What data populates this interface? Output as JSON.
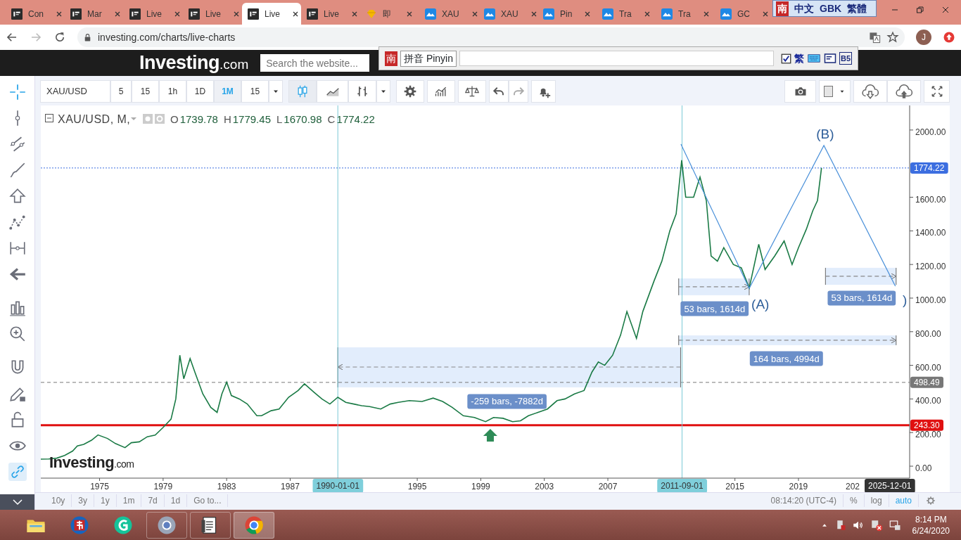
{
  "browser": {
    "tabs": [
      {
        "label": "Con",
        "kind": "investing",
        "selected": false
      },
      {
        "label": "Mar",
        "kind": "investing",
        "selected": false
      },
      {
        "label": "Live",
        "kind": "investing",
        "selected": false
      },
      {
        "label": "Live",
        "kind": "investing",
        "selected": false
      },
      {
        "label": "Live",
        "kind": "investing",
        "selected": true
      },
      {
        "label": "Live",
        "kind": "investing",
        "selected": false
      },
      {
        "label": "即",
        "kind": "gem",
        "selected": false
      },
      {
        "label": "XAU",
        "kind": "cloud",
        "selected": false
      },
      {
        "label": "XAU",
        "kind": "cloud",
        "selected": false
      },
      {
        "label": "Pin",
        "kind": "cloud",
        "selected": false
      },
      {
        "label": "Tra",
        "kind": "cloud",
        "selected": false
      },
      {
        "label": "Tra",
        "kind": "cloud",
        "selected": false
      },
      {
        "label": "GC",
        "kind": "cloud",
        "selected": false
      }
    ],
    "url": "investing.com/charts/live-charts",
    "avatar": "J"
  },
  "ime": {
    "status": [
      "南",
      "中文",
      "GBK",
      "繁體"
    ],
    "pinyin": {
      "logo": "南",
      "mode": "拼音 Pinyin",
      "traditional_checked": true,
      "traditional": "繁",
      "b5": "B5"
    }
  },
  "site": {
    "logo": "Investing",
    "logo_suffix": ".com",
    "search": {
      "placeholder": "Search the website..."
    }
  },
  "toolbar": {
    "symbol": "XAU/USD",
    "intervals": [
      {
        "label": "5",
        "selected": false
      },
      {
        "label": "15",
        "selected": false
      },
      {
        "label": "1h",
        "selected": false
      },
      {
        "label": "1D",
        "selected": false
      },
      {
        "label": "1M",
        "selected": true
      },
      {
        "label": "15",
        "selected": false
      }
    ]
  },
  "chart": {
    "title": "XAU/USD, M,",
    "ohlc": [
      {
        "key": "O",
        "value": "1739.78"
      },
      {
        "key": "H",
        "value": "1779.45"
      },
      {
        "key": "L",
        "value": "1670.98"
      },
      {
        "key": "C",
        "value": "1774.22"
      }
    ],
    "logo": "Investing",
    "logo_suffix": ".com",
    "measurements": [
      "-259 bars, -7882d",
      "53 bars, 1614d",
      "53 bars, 1614d",
      "164 bars, 4994d"
    ],
    "wave_labels": [
      "(A)",
      "(B)",
      ")"
    ],
    "cut_tick": "202",
    "cursor_date": "2025-12-01",
    "date_markers": [
      "1990-01-01",
      "2011-09-01"
    ],
    "chart_data": {
      "type": "line",
      "x": [
        1971.3,
        1971.8,
        1972.3,
        1972.8,
        1973.3,
        1973.6,
        1974.0,
        1974.5,
        1974.9,
        1975.5,
        1976.0,
        1976.6,
        1977.0,
        1977.5,
        1978.0,
        1978.5,
        1979.0,
        1979.5,
        1979.8,
        1980.05,
        1980.3,
        1980.7,
        1981.0,
        1981.5,
        1982.0,
        1982.4,
        1982.7,
        1983.0,
        1983.3,
        1983.8,
        1984.3,
        1984.9,
        1985.2,
        1985.8,
        1986.3,
        1986.9,
        1987.5,
        1987.9,
        1988.5,
        1989.0,
        1989.5,
        1990.0,
        1990.5,
        1991.0,
        1991.5,
        1992.0,
        1992.7,
        1993.3,
        1993.8,
        1994.5,
        1995.3,
        1996.0,
        1996.6,
        1997.2,
        1997.9,
        1998.6,
        1999.3,
        1999.8,
        2000.4,
        2001.0,
        2001.5,
        2002.0,
        2002.6,
        2003.2,
        2003.8,
        2004.3,
        2004.9,
        2005.5,
        2006.0,
        2006.4,
        2006.8,
        2007.3,
        2007.8,
        2008.2,
        2008.8,
        2009.2,
        2009.9,
        2010.4,
        2010.9,
        2011.3,
        2011.65,
        2011.9,
        2012.4,
        2012.8,
        2013.2,
        2013.5,
        2013.9,
        2014.3,
        2014.9,
        2015.4,
        2015.9,
        2016.5,
        2016.9,
        2017.5,
        2018.1,
        2018.6,
        2019.0,
        2019.5,
        2019.9,
        2020.2,
        2020.45
      ],
      "series": [
        {
          "color": "#1a7a45",
          "values": [
            42,
            43,
            48,
            64,
            90,
            120,
            130,
            155,
            186,
            165,
            135,
            110,
            140,
            145,
            175,
            185,
            230,
            280,
            400,
            660,
            520,
            640,
            560,
            430,
            350,
            320,
            430,
            500,
            420,
            400,
            370,
            300,
            300,
            330,
            340,
            410,
            450,
            490,
            440,
            400,
            370,
            410,
            380,
            370,
            360,
            355,
            340,
            370,
            380,
            390,
            385,
            405,
            385,
            350,
            300,
            290,
            265,
            290,
            285,
            265,
            270,
            300,
            320,
            340,
            390,
            400,
            430,
            450,
            560,
            620,
            600,
            660,
            780,
            920,
            760,
            920,
            1100,
            1220,
            1400,
            1500,
            1820,
            1600,
            1600,
            1720,
            1580,
            1250,
            1220,
            1300,
            1200,
            1180,
            1060,
            1320,
            1170,
            1250,
            1340,
            1200,
            1300,
            1410,
            1520,
            1580,
            1774
          ]
        }
      ],
      "xlim": [
        1971.3,
        2026.0
      ],
      "ylim": [
        -71,
        2146
      ],
      "xticks": [
        {
          "value": 1975,
          "label": "1975"
        },
        {
          "value": 1979,
          "label": "1979"
        },
        {
          "value": 1983,
          "label": "1983"
        },
        {
          "value": 1987,
          "label": "1987"
        },
        {
          "value": 1995,
          "label": "1995"
        },
        {
          "value": 1999,
          "label": "1999"
        },
        {
          "value": 2003,
          "label": "2003"
        },
        {
          "value": 2007,
          "label": "2007"
        },
        {
          "value": 2015,
          "label": "2015"
        },
        {
          "value": 2019,
          "label": "2019"
        }
      ],
      "yticks": [
        {
          "value": 0,
          "label": "0.00"
        },
        {
          "value": 200,
          "label": "200.00"
        },
        {
          "value": 400,
          "label": "400.00"
        },
        {
          "value": 600,
          "label": "600.00"
        },
        {
          "value": 800,
          "label": "800.00"
        },
        {
          "value": 1000,
          "label": "1000.00"
        },
        {
          "value": 1200,
          "label": "1200.00"
        },
        {
          "value": 1400,
          "label": "1400.00"
        },
        {
          "value": 1600,
          "label": "1600.00"
        },
        {
          "value": 2000,
          "label": "2000.00"
        }
      ],
      "ref_lines": [
        {
          "axis": "y",
          "value": 1774.22,
          "label": "1774.22",
          "color": "#3c6ee0"
        },
        {
          "axis": "y",
          "value": 498.49,
          "label": "498.49",
          "color": "#777777"
        },
        {
          "axis": "y",
          "value": 243.3,
          "label": "243.30",
          "color": "#e01010"
        },
        {
          "axis": "x",
          "value": 1990.0,
          "color": "#7cc9d6"
        },
        {
          "axis": "x",
          "value": 2011.67,
          "color": "#7cc9d6"
        }
      ]
    }
  },
  "bottom_bar": {
    "ranges": [
      "10y",
      "3y",
      "1y",
      "1m",
      "7d",
      "1d",
      "Go to..."
    ],
    "time": "08:14:20 (UTC-4)",
    "scales": [
      {
        "label": "%",
        "selected": false
      },
      {
        "label": "log",
        "selected": false
      },
      {
        "label": "auto",
        "selected": true
      }
    ]
  },
  "taskbar": {
    "time": "8:14 PM",
    "date": "6/24/2020"
  }
}
